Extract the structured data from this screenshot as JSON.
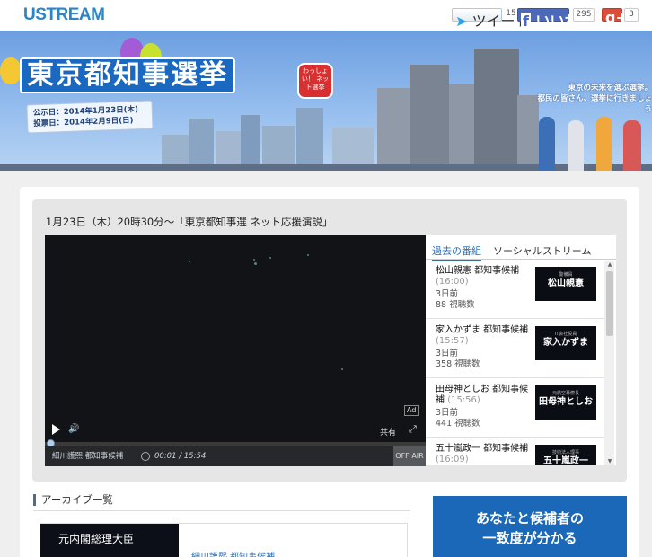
{
  "header": {
    "logo": "USTREAM",
    "social": {
      "tweet_label": "ツイート",
      "tweet_count": "15",
      "like_label": "いいね！",
      "like_count": "295",
      "plusone_label": "g+1",
      "plusone_count": "3"
    }
  },
  "banner": {
    "title": "東京都知事選挙",
    "badge": "わっしょい！ ネット選挙",
    "announce_date": "公示日：2014年1月23日(木)",
    "vote_date": "投票日：2014年2月9日(日)",
    "slogan_line1": "東京の未来を選ぶ選挙。",
    "slogan_line2": "都民の皆さん、選挙に行きましょう"
  },
  "player": {
    "title": "1月23日（木）20時30分～「東京都知事選 ネット応援演説」",
    "ad_label": "Ad",
    "share_label": "共有",
    "channel_name": "細川護熙 都知事候補",
    "time": "00:01 / 15:54",
    "status": "OFF AIR",
    "progress": 0.001
  },
  "side": {
    "tabs": [
      {
        "label": "過去の番組",
        "active": true
      },
      {
        "label": "ソーシャルストリーム",
        "active": false
      }
    ],
    "items": [
      {
        "title": "松山親憲 都知事候補",
        "duration": "(16:00)",
        "ago": "3日前",
        "views": "88 視聴数",
        "thumb_sub": "警備員",
        "thumb_name": "松山親憲"
      },
      {
        "title": "家入かずま 都知事候補",
        "duration": "(15:57)",
        "ago": "3日前",
        "views": "358 視聴数",
        "thumb_sub": "IT会社役員",
        "thumb_name": "家入かずま"
      },
      {
        "title": "田母神としお 都知事候補",
        "duration": "(15:56)",
        "ago": "3日前",
        "views": "441 視聴数",
        "thumb_sub": "元航空幕僚長",
        "thumb_name": "田母神としお"
      },
      {
        "title": "五十嵐政一 都知事候補",
        "duration": "(16:09)",
        "ago": "",
        "views": "",
        "thumb_sub": "技術法人理事",
        "thumb_name": "五十嵐政一"
      }
    ]
  },
  "archive": {
    "heading": "アーカイブ一覧",
    "card_thumb": "元内閣総理大臣",
    "card_title": "細川護熙 都知事候補"
  },
  "promo": {
    "line1": "あなたと候補者の",
    "line2": "一致度が分かる"
  }
}
